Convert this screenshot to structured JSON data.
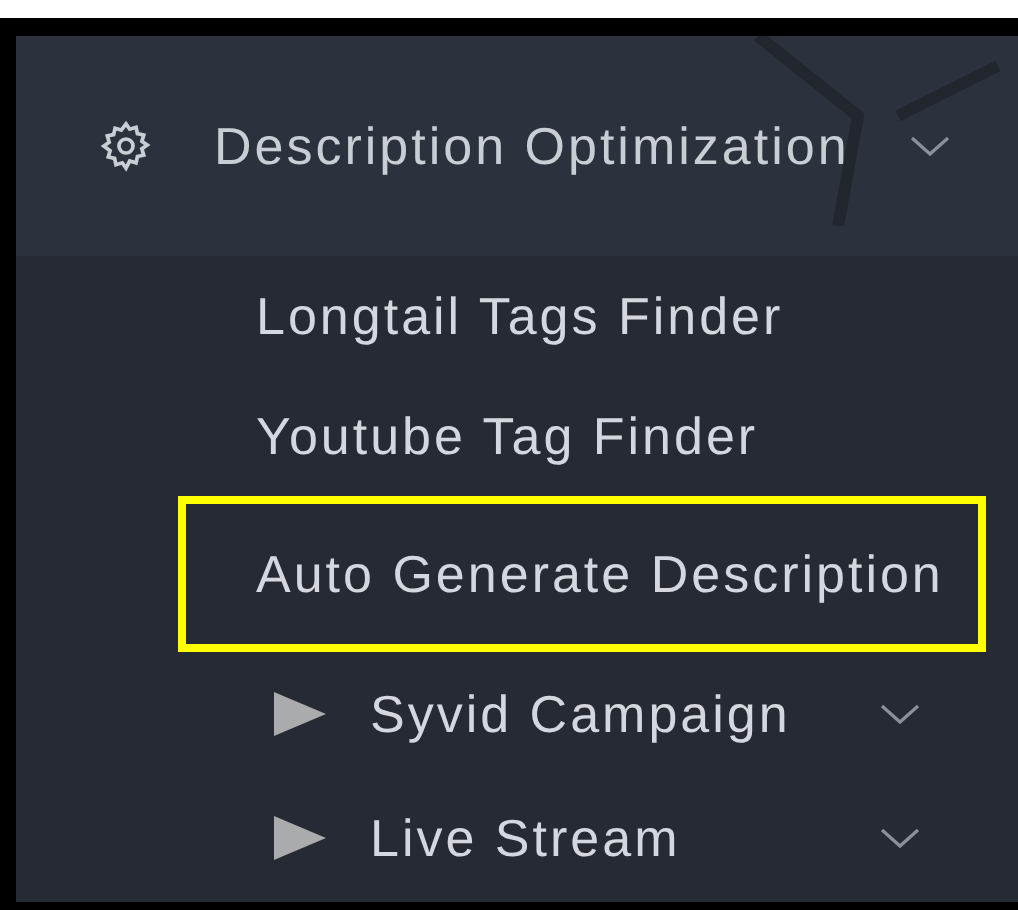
{
  "menu": {
    "title": "Description Optimization",
    "expanded": true,
    "items": [
      {
        "kind": "link",
        "label": "Longtail Tags Finder",
        "highlighted": false
      },
      {
        "kind": "link",
        "label": "Youtube Tag Finder",
        "highlighted": false
      },
      {
        "kind": "link",
        "label": "Auto Generate Description",
        "highlighted": true
      },
      {
        "kind": "group",
        "label": "Syvid Campaign",
        "highlighted": false
      },
      {
        "kind": "group",
        "label": "Live Stream",
        "highlighted": false
      }
    ]
  }
}
